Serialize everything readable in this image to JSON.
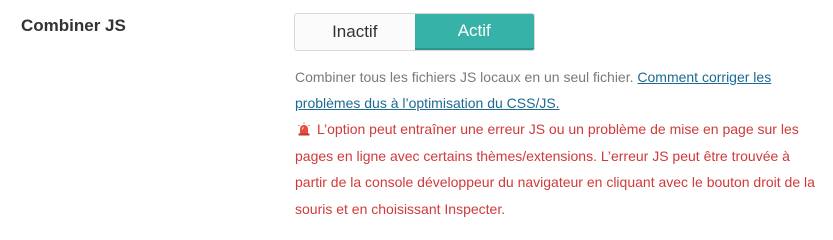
{
  "setting": {
    "label": "Combiner JS",
    "toggle": {
      "off_label": "Inactif",
      "on_label": "Actif",
      "selected": "Actif"
    },
    "description": {
      "text": "Combiner tous les fichiers JS locaux en un seul fichier. ",
      "link_text": "Comment corriger les problèmes dus à l’optimisation du CSS/JS."
    },
    "warning": {
      "icon": "alarm-light-icon",
      "text": "L’option peut entraîner une erreur JS ou un problème de mise en page sur les pages en ligne avec certains thèmes/extensions. L’erreur JS peut être trouvée à partir de la console développeur du navigateur en cliquant avec le bouton droit de la souris et en choisissant Inspecter."
    }
  },
  "colors": {
    "accent": "#36b2a9",
    "link": "#1d6a92",
    "warning": "#d03a3a",
    "muted": "#7a7a7a"
  }
}
